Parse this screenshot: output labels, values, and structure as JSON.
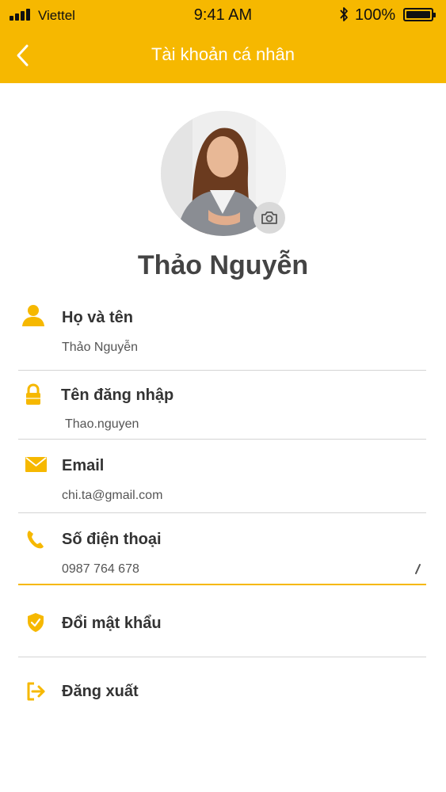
{
  "status_bar": {
    "carrier": "Viettel",
    "time": "9:41 AM",
    "battery": "100%"
  },
  "header": {
    "title": "Tài khoản cá nhân"
  },
  "profile": {
    "name": "Thảo Nguyễn"
  },
  "fields": {
    "full_name": {
      "label": "Họ và tên",
      "value": "Thảo Nguyễn"
    },
    "username": {
      "label": "Tên đăng nhập",
      "value": "Thao.nguyen"
    },
    "email": {
      "label": "Email",
      "value": "chi.ta@gmail.com"
    },
    "phone": {
      "label": "Số điện thoại",
      "value": "0987 764 678"
    }
  },
  "actions": {
    "change_password": "Đổi mật khẩu",
    "logout": "Đăng xuất"
  },
  "colors": {
    "accent": "#f6b800",
    "divider": "#d4d4d4"
  }
}
